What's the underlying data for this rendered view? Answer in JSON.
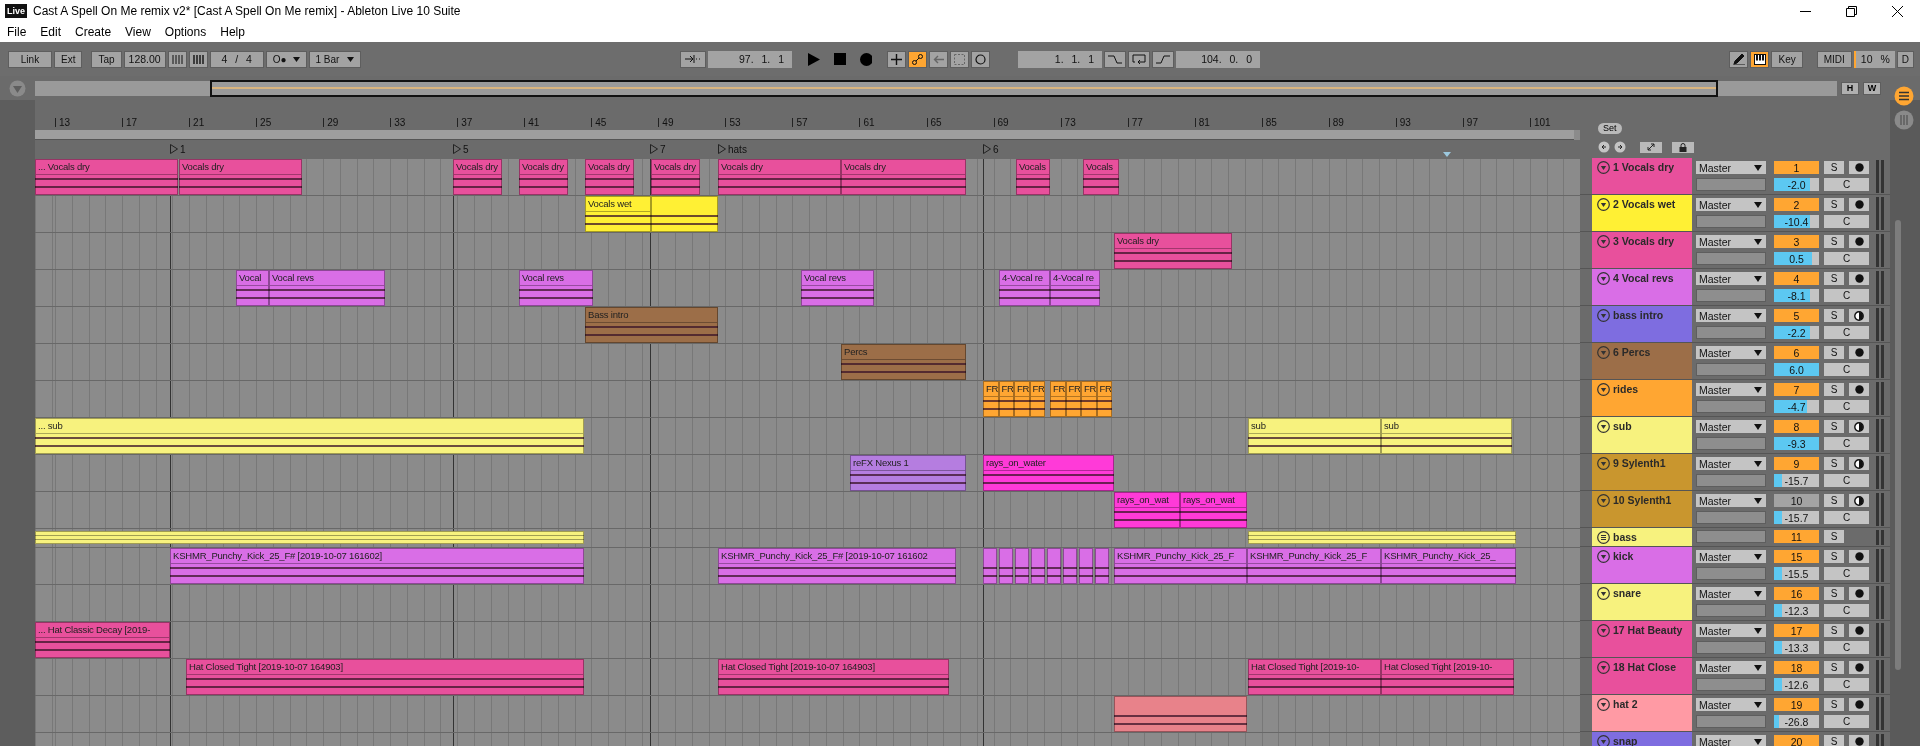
{
  "window": {
    "logo": "Live",
    "title": "Cast A Spell On Me remix v2*  [Cast A Spell On Me remix] - Ableton Live 10 Suite"
  },
  "menu": [
    "File",
    "Edit",
    "Create",
    "View",
    "Options",
    "Help"
  ],
  "control_bar": {
    "link": "Link",
    "ext": "Ext",
    "tap": "Tap",
    "tempo": "128.00",
    "signature": "4 / 4",
    "metronome": "O●",
    "quantization": "1 Bar",
    "position": "97.  1.  1",
    "follow": true,
    "loop_start": "1.  1.  1",
    "loop_length": "104.  0.  0",
    "draw_mode": false,
    "keyboard_midi": true,
    "key": "Key",
    "midi": "MIDI",
    "cpu": "10 %",
    "disk": "D"
  },
  "overview": {
    "buttons": [
      "H",
      "W"
    ]
  },
  "ruler": [
    "13",
    "17",
    "21",
    "25",
    "29",
    "33",
    "37",
    "41",
    "45",
    "49",
    "53",
    "57",
    "61",
    "65",
    "69",
    "73",
    "77",
    "81",
    "85",
    "89",
    "93",
    "97",
    "101"
  ],
  "locators": [
    {
      "label": "1"
    },
    {
      "label": "5"
    },
    {
      "label": "7"
    },
    {
      "label": "hats"
    },
    {
      "label": "6"
    }
  ],
  "set_button": "Set",
  "tracks": [
    {
      "name": "1 Vocals dry",
      "color": "#e8509c",
      "kind": "audio",
      "routing": "Master",
      "number": "1",
      "active": true,
      "volume": "-2.0",
      "level": 0.8,
      "solo": "S",
      "pan": "C",
      "midi": false,
      "clips": [
        {
          "name": "... Vocals dry",
          "color": "#e8509c"
        },
        {
          "name": "Vocals dry",
          "color": "#e8509c"
        },
        {
          "name": "Vocals dry",
          "color": "#e8509c"
        },
        {
          "name": "Vocals dry",
          "color": "#e8509c"
        },
        {
          "name": "Vocals dry",
          "color": "#e8509c"
        },
        {
          "name": "Vocals dry",
          "color": "#e8509c"
        },
        {
          "name": "Vocals dry",
          "color": "#e8509c"
        },
        {
          "name": "Vocals dry",
          "color": "#e8509c"
        },
        {
          "name": "Vocals",
          "color": "#e8509c"
        },
        {
          "name": "Vocals",
          "color": "#e8509c"
        }
      ]
    },
    {
      "name": "2 Vocals wet",
      "color": "#fff034",
      "kind": "audio",
      "routing": "Master",
      "number": "2",
      "active": true,
      "volume": "-10.4",
      "level": 0.8,
      "solo": "S",
      "pan": "C",
      "midi": false,
      "clips": [
        {
          "name": "Vocals wet",
          "color": "#fff034"
        },
        {
          "color": "#fff034"
        }
      ]
    },
    {
      "name": "3 Vocals dry",
      "color": "#e8509c",
      "kind": "audio",
      "routing": "Master",
      "number": "3",
      "active": true,
      "volume": "0.5",
      "level": 0.85,
      "solo": "S",
      "pan": "C",
      "midi": false,
      "clips": [
        {
          "name": "Vocals dry",
          "color": "#e8509c"
        }
      ]
    },
    {
      "name": "4 Vocal revs",
      "color": "#d96ee6",
      "kind": "audio",
      "routing": "Master",
      "number": "4",
      "active": true,
      "volume": "-8.1",
      "level": 0.8,
      "solo": "S",
      "pan": "C",
      "midi": false,
      "clips": [
        {
          "name": "Vocal",
          "color": "#d96ee6"
        },
        {
          "name": "Vocal revs",
          "color": "#d96ee6"
        },
        {
          "name": "Vocal revs",
          "color": "#d96ee6"
        },
        {
          "name": "Vocal revs",
          "color": "#d96ee6"
        },
        {
          "name": "4-Vocal re",
          "color": "#d96ee6"
        },
        {
          "name": "4-Vocal re",
          "color": "#d96ee6"
        }
      ]
    },
    {
      "name": "bass intro",
      "color": "#7e6de0",
      "kind": "audio",
      "routing": "Master",
      "number": "5",
      "active": true,
      "volume": "-2.2",
      "level": 0.8,
      "solo": "S",
      "pan": "C",
      "midi": true,
      "clips": [
        {
          "name": "Bass intro",
          "color": "#9c6e48"
        }
      ]
    },
    {
      "name": "6 Percs",
      "color": "#9c6e48",
      "kind": "audio",
      "routing": "Master",
      "number": "6",
      "active": true,
      "volume": "6.0",
      "level": 1,
      "solo": "S",
      "pan": "C",
      "midi": false,
      "clips": [
        {
          "name": "Percs",
          "color": "#9c6e48"
        }
      ]
    },
    {
      "name": "rides",
      "color": "#ffa632",
      "kind": "audio",
      "routing": "Master",
      "number": "7",
      "active": true,
      "volume": "-4.7",
      "level": 0.74,
      "solo": "S",
      "pan": "C",
      "midi": false,
      "clips": [
        {
          "name": "FR",
          "color": "#ffa632"
        },
        {
          "name": "FR",
          "color": "#ffa632"
        },
        {
          "name": "FR",
          "color": "#ffa632"
        },
        {
          "name": "FR",
          "color": "#ffa632"
        },
        {
          "name": "FR",
          "color": "#ffa632"
        },
        {
          "name": "FR",
          "color": "#ffa632"
        },
        {
          "name": "FR",
          "color": "#ffa632"
        },
        {
          "name": "FR",
          "color": "#ffa632"
        }
      ]
    },
    {
      "name": "sub",
      "color": "#f7f27e",
      "kind": "audio",
      "routing": "Master",
      "number": "8",
      "active": true,
      "volume": "-9.3",
      "level": 1,
      "solo": "S",
      "pan": "C",
      "midi": true,
      "clips": [
        {
          "name": "... sub",
          "color": "#f7f27e"
        },
        {
          "name": "sub",
          "color": "#f7f27e"
        },
        {
          "name": "sub",
          "color": "#f7f27e"
        }
      ]
    },
    {
      "name": "9 Sylenth1",
      "color": "#c9962e",
      "kind": "audio",
      "routing": "Master",
      "number": "9",
      "active": true,
      "volume": "-15.7",
      "level": 0.18,
      "solo": "S",
      "pan": "C",
      "midi": true,
      "clips": [
        {
          "name": "reFX Nexus 1",
          "color": "#b57de0"
        },
        {
          "name": "rays_on_water",
          "color": "#ff3ad8"
        }
      ]
    },
    {
      "name": "10 Sylenth1",
      "color": "#c9962e",
      "kind": "audio",
      "routing": "Master",
      "number": "10",
      "active": false,
      "volume": "-15.7",
      "level": 0.18,
      "solo": "S",
      "pan": "C",
      "midi": true,
      "clips": [
        {
          "name": "rays_on_wat",
          "color": "#ff3ad8"
        },
        {
          "name": "rays_on_wat",
          "color": "#ff3ad8"
        }
      ]
    },
    {
      "name": "bass",
      "color": "#f7f27e",
      "kind": "group",
      "number": "11",
      "active": true,
      "solo": "S",
      "clips": [
        {
          "color": "#f7f27e"
        },
        {
          "color": "#f7f27e"
        }
      ]
    },
    {
      "name": "kick",
      "color": "#d96ee6",
      "kind": "audio",
      "routing": "Master",
      "number": "15",
      "active": true,
      "volume": "-15.5",
      "level": 0.18,
      "solo": "S",
      "pan": "C",
      "midi": false,
      "clips": [
        {
          "name": "KSHMR_Punchy_Kick_25_F# [2019-10-07 161602]",
          "color": "#d96ee6"
        },
        {
          "name": "KSHMR_Punchy_Kick_25_F# [2019-10-07 161602",
          "color": "#d96ee6"
        },
        {
          "color": "#d96ee6"
        },
        {
          "color": "#d96ee6"
        },
        {
          "color": "#d96ee6"
        },
        {
          "color": "#d96ee6"
        },
        {
          "color": "#d96ee6"
        },
        {
          "color": "#d96ee6"
        },
        {
          "color": "#d96ee6"
        },
        {
          "color": "#d96ee6"
        },
        {
          "name": "KSHMR_Punchy_Kick_25_F",
          "color": "#d96ee6"
        },
        {
          "name": "KSHMR_Punchy_Kick_25_F",
          "color": "#d96ee6"
        },
        {
          "name": "KSHMR_Punchy_Kick_25_",
          "color": "#d96ee6"
        }
      ]
    },
    {
      "name": "snare",
      "color": "#f7f27e",
      "kind": "audio",
      "routing": "Master",
      "number": "16",
      "active": true,
      "volume": "-12.3",
      "level": 0.18,
      "solo": "S",
      "pan": "C",
      "midi": false
    },
    {
      "name": "17 Hat Beauty",
      "color": "#e8509c",
      "kind": "audio",
      "routing": "Master",
      "number": "17",
      "active": true,
      "volume": "-13.3",
      "level": 0.18,
      "solo": "S",
      "pan": "C",
      "midi": false,
      "clips": [
        {
          "name": "... Hat Classic Decay [2019-",
          "color": "#e8509c"
        }
      ]
    },
    {
      "name": "18 Hat Close",
      "color": "#e8509c",
      "kind": "audio",
      "routing": "Master",
      "number": "18",
      "active": true,
      "volume": "-12.6",
      "level": 0.18,
      "solo": "S",
      "pan": "C",
      "midi": false,
      "clips": [
        {
          "name": "Hat Closed Tight [2019-10-07 164903]",
          "color": "#e8509c"
        },
        {
          "name": "Hat Closed Tight [2019-10-07 164903]",
          "color": "#e8509c"
        },
        {
          "name": "Hat Closed Tight [2019-10-",
          "color": "#e8509c"
        },
        {
          "name": "Hat Closed Tight [2019-10-",
          "color": "#e8509c"
        }
      ]
    },
    {
      "name": "hat 2",
      "color": "#ff9aa4",
      "kind": "audio",
      "routing": "Master",
      "number": "19",
      "active": true,
      "volume": "-26.8",
      "level": 0.12,
      "solo": "S",
      "pan": "C",
      "midi": false,
      "clips": [
        {
          "color": "#e8828a"
        }
      ]
    },
    {
      "name": "snap",
      "color": "#7e6de0",
      "kind": "audio",
      "routing": "Master",
      "number": "20",
      "active": true,
      "solo": "S",
      "midi": false
    }
  ]
}
